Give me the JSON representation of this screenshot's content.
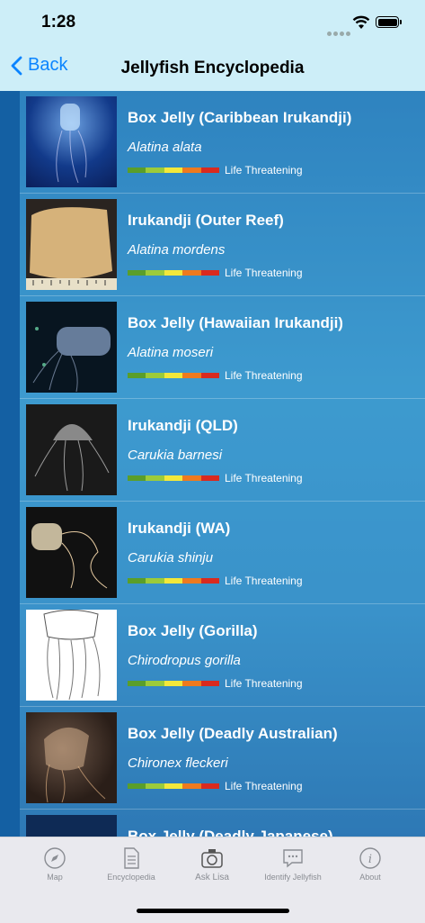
{
  "status": {
    "time": "1:28"
  },
  "nav": {
    "back_label": "Back",
    "title": "Jellyfish Encyclopedia"
  },
  "severity_colors": [
    "#5a9e2a",
    "#9ccb3a",
    "#f3e83a",
    "#ee7a1e",
    "#d92a1f"
  ],
  "items": [
    {
      "name": "Box Jelly (Caribbean Irukandji)",
      "scientific": "Alatina alata",
      "danger": "Life Threatening"
    },
    {
      "name": "Irukandji (Outer Reef)",
      "scientific": "Alatina mordens",
      "danger": "Life Threatening"
    },
    {
      "name": "Box Jelly (Hawaiian Irukandji)",
      "scientific": "Alatina moseri",
      "danger": "Life Threatening"
    },
    {
      "name": "Irukandji (QLD)",
      "scientific": "Carukia barnesi",
      "danger": "Life Threatening"
    },
    {
      "name": "Irukandji (WA)",
      "scientific": "Carukia shinju",
      "danger": "Life Threatening"
    },
    {
      "name": "Box Jelly (Gorilla)",
      "scientific": "Chirodropus gorilla",
      "danger": "Life Threatening"
    },
    {
      "name": "Box Jelly (Deadly Australian)",
      "scientific": "Chironex fleckeri",
      "danger": "Life Threatening"
    },
    {
      "name": "Box Jelly (Deadly Japanese)",
      "scientific": "",
      "danger": ""
    }
  ],
  "tabs": [
    {
      "label": "Map",
      "icon": "compass-icon"
    },
    {
      "label": "Encyclopedia",
      "icon": "document-icon"
    },
    {
      "label": "Ask Lisa",
      "icon": "camera-icon"
    },
    {
      "label": "Identify Jellyfish",
      "icon": "chat-bubble-icon"
    },
    {
      "label": "About",
      "icon": "info-icon"
    }
  ]
}
